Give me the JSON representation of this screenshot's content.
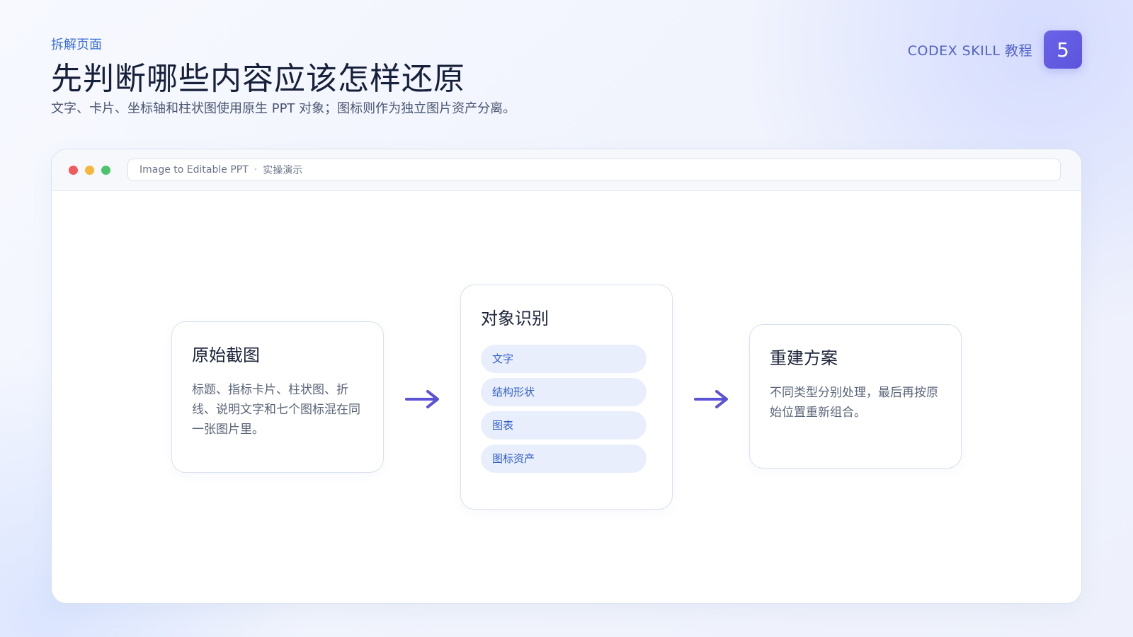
{
  "header": {
    "eyebrow": "拆解页面",
    "title": "先判断哪些内容应该怎样还原",
    "subtitle": "文字、卡片、坐标轴和柱状图使用原生 PPT 对象；图标则作为独立图片资产分离。"
  },
  "brand": {
    "label": "CODEX SKILL 教程",
    "page_number": "5"
  },
  "window": {
    "address_app": "Image to Editable PPT",
    "address_separator": "·",
    "address_context": "实操演示"
  },
  "cards": {
    "original": {
      "title": "原始截图",
      "text": "标题、指标卡片、柱状图、折线、说明文字和七个图标混在同一张图片里。"
    },
    "recognition": {
      "title": "对象识别",
      "chips": [
        "文字",
        "结构形状",
        "图表",
        "图标资产"
      ]
    },
    "rebuild": {
      "title": "重建方案",
      "text": "不同类型分别处理，最后再按原始位置重新组合。"
    }
  },
  "colors": {
    "accent": "#5b52d6",
    "eyebrow": "#3b6fd6",
    "chip_bg": "#e9eefc",
    "chip_text": "#2f5fc4",
    "page_badge": "#6a63e8"
  },
  "icons": {
    "flow_arrow": "arrow-right-icon"
  }
}
